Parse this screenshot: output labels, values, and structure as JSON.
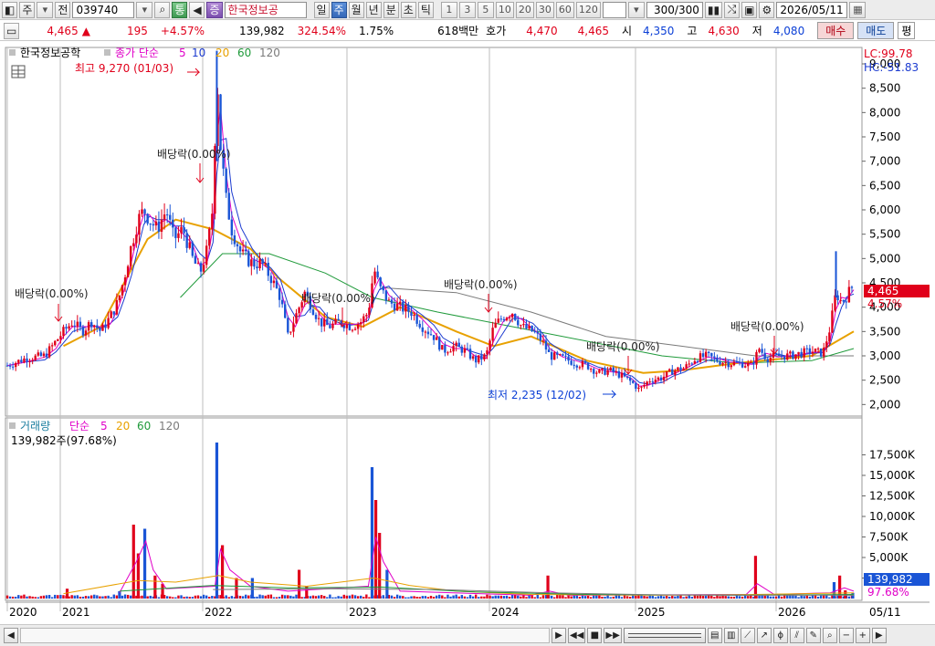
{
  "toolbar": {
    "market": "주",
    "period_mode": "전",
    "stock_code": "039740",
    "btn_tong": "통",
    "btn_jeung": "증",
    "stock_name": "한국정보공",
    "tabs": [
      "일",
      "주",
      "월",
      "년",
      "분",
      "초",
      "틱"
    ],
    "active_tab": "주",
    "intervals": [
      "1",
      "3",
      "5",
      "10",
      "20",
      "30",
      "60",
      "120"
    ],
    "count": "300/300",
    "date": "2026/05/11"
  },
  "quote": {
    "price": "4,465",
    "arrow": "▲",
    "change": "195",
    "change_pct": "+4.57%",
    "volume": "139,982",
    "volume_ratio": "324.54%",
    "turnover": "1.75%",
    "amount": "618백만",
    "hoga_label": "호가",
    "ask": "4,470",
    "bid": "4,465",
    "open_label": "시",
    "open": "4,350",
    "high_label": "고",
    "high": "4,630",
    "low_label": "저",
    "low": "4,080",
    "buy": "매수",
    "sell": "매도",
    "flat": "평"
  },
  "price_panel": {
    "stock_label": "한국정보공학",
    "ma_label": "종가 단순",
    "ma_periods": [
      "5",
      "10",
      "20",
      "60",
      "120"
    ],
    "lc": "LC:99.78",
    "hc": "HC:-51.83",
    "current_price": "4,465",
    "current_pct": "4.57%",
    "high_note": "최고 9,270 (01/03)",
    "low_note": "최저 2,235 (12/02)",
    "dividend_label": "배당락(0.00%)",
    "colors": {
      "ma5": "#e000c8",
      "ma10": "#1c3bd0",
      "ma20": "#e8a100",
      "ma60": "#1f9a3a",
      "ma120": "#7a7a7a",
      "up": "#e0001b",
      "down": "#1a55d6"
    }
  },
  "volume_panel": {
    "label": "거래량",
    "ma_label": "단순",
    "ma_periods": [
      "5",
      "20",
      "60",
      "120"
    ],
    "volume_text": "139,982주(97.68%)",
    "current_volume": "139,982",
    "current_pct": "97.68%"
  },
  "x_axis": {
    "labels": [
      "2020",
      "2021",
      "2022",
      "2023",
      "2024",
      "2025",
      "2026"
    ],
    "end_label": "05/11"
  },
  "chart_data": {
    "type": "candlestick",
    "price_ticks": [
      2000,
      2500,
      3000,
      3500,
      4000,
      4500,
      5000,
      5500,
      6000,
      6500,
      7000,
      7500,
      8000,
      8500,
      9000
    ],
    "price_ylim": [
      1800,
      9300
    ],
    "volume_ticks": [
      "2,500K",
      "5,000K",
      "7,500K",
      "10,000K",
      "12,500K",
      "15,000K",
      "17,500K"
    ],
    "volume_ylim": [
      0,
      20000
    ],
    "volume_unit": "K",
    "years": [
      "2020",
      "2021",
      "2022",
      "2023",
      "2024",
      "2025",
      "2026"
    ],
    "price_path": [
      [
        0,
        2800
      ],
      [
        20,
        2950
      ],
      [
        40,
        3000
      ],
      [
        52,
        3300
      ],
      [
        60,
        3500
      ],
      [
        70,
        3700
      ],
      [
        80,
        3500
      ],
      [
        90,
        3700
      ],
      [
        100,
        3500
      ],
      [
        110,
        3800
      ],
      [
        118,
        4100
      ],
      [
        125,
        4600
      ],
      [
        133,
        5300
      ],
      [
        140,
        5800
      ],
      [
        146,
        6000
      ],
      [
        152,
        5800
      ],
      [
        160,
        5600
      ],
      [
        170,
        6000
      ],
      [
        178,
        5400
      ],
      [
        188,
        5600
      ],
      [
        198,
        5000
      ],
      [
        206,
        4700
      ],
      [
        214,
        5200
      ],
      [
        220,
        6100
      ],
      [
        224,
        8900
      ],
      [
        228,
        7300
      ],
      [
        234,
        6200
      ],
      [
        240,
        5600
      ],
      [
        250,
        5100
      ],
      [
        262,
        4900
      ],
      [
        272,
        4900
      ],
      [
        282,
        4600
      ],
      [
        292,
        4200
      ],
      [
        300,
        3400
      ],
      [
        308,
        3800
      ],
      [
        318,
        4300
      ],
      [
        326,
        4000
      ],
      [
        334,
        3700
      ],
      [
        344,
        3600
      ],
      [
        356,
        3700
      ],
      [
        368,
        3600
      ],
      [
        378,
        3700
      ],
      [
        386,
        3900
      ],
      [
        392,
        4800
      ],
      [
        398,
        4400
      ],
      [
        408,
        4100
      ],
      [
        420,
        4000
      ],
      [
        432,
        3900
      ],
      [
        444,
        3600
      ],
      [
        456,
        3400
      ],
      [
        466,
        3100
      ],
      [
        478,
        3200
      ],
      [
        490,
        3100
      ],
      [
        500,
        2900
      ],
      [
        512,
        3000
      ],
      [
        520,
        3600
      ],
      [
        530,
        3800
      ],
      [
        540,
        3900
      ],
      [
        550,
        3600
      ],
      [
        562,
        3500
      ],
      [
        572,
        3300
      ],
      [
        580,
        3000
      ],
      [
        594,
        2950
      ],
      [
        608,
        2850
      ],
      [
        620,
        2800
      ],
      [
        632,
        2650
      ],
      [
        644,
        2700
      ],
      [
        656,
        2600
      ],
      [
        668,
        2450
      ],
      [
        676,
        2300
      ],
      [
        686,
        2500
      ],
      [
        700,
        2550
      ],
      [
        712,
        2700
      ],
      [
        724,
        2750
      ],
      [
        736,
        2950
      ],
      [
        748,
        3000
      ],
      [
        760,
        2900
      ],
      [
        772,
        2850
      ],
      [
        784,
        2850
      ],
      [
        796,
        2800
      ],
      [
        804,
        3150
      ],
      [
        812,
        2950
      ],
      [
        824,
        3000
      ],
      [
        836,
        3000
      ],
      [
        848,
        3050
      ],
      [
        860,
        3100
      ],
      [
        872,
        3050
      ],
      [
        880,
        3600
      ],
      [
        886,
        4300
      ],
      [
        892,
        4100
      ],
      [
        898,
        4250
      ],
      [
        905,
        4465
      ]
    ],
    "ma20": [
      [
        60,
        3200
      ],
      [
        100,
        3600
      ],
      [
        150,
        5400
      ],
      [
        180,
        5800
      ],
      [
        220,
        5600
      ],
      [
        260,
        5200
      ],
      [
        290,
        4600
      ],
      [
        340,
        3800
      ],
      [
        380,
        3600
      ],
      [
        420,
        4000
      ],
      [
        480,
        3500
      ],
      [
        520,
        3200
      ],
      [
        560,
        3400
      ],
      [
        620,
        2900
      ],
      [
        680,
        2650
      ],
      [
        720,
        2700
      ],
      [
        780,
        2850
      ],
      [
        860,
        3000
      ],
      [
        905,
        3500
      ]
    ],
    "ma60": [
      [
        185,
        4200
      ],
      [
        230,
        5100
      ],
      [
        280,
        5100
      ],
      [
        340,
        4700
      ],
      [
        390,
        4200
      ],
      [
        460,
        3900
      ],
      [
        540,
        3600
      ],
      [
        620,
        3300
      ],
      [
        700,
        3000
      ],
      [
        780,
        2850
      ],
      [
        860,
        2900
      ],
      [
        905,
        3150
      ]
    ],
    "ma120": [
      [
        400,
        4400
      ],
      [
        480,
        4300
      ],
      [
        560,
        3900
      ],
      [
        640,
        3400
      ],
      [
        720,
        3200
      ],
      [
        800,
        3000
      ],
      [
        905,
        3000
      ]
    ],
    "volume_bars": [
      [
        64,
        1200
      ],
      [
        120,
        900
      ],
      [
        135,
        9000
      ],
      [
        140,
        5500
      ],
      [
        147,
        8500
      ],
      [
        158,
        2800
      ],
      [
        166,
        1800
      ],
      [
        224,
        19000
      ],
      [
        230,
        6500
      ],
      [
        245,
        2500
      ],
      [
        262,
        2500
      ],
      [
        312,
        3500
      ],
      [
        320,
        1500
      ],
      [
        390,
        16000
      ],
      [
        394,
        12000
      ],
      [
        398,
        8000
      ],
      [
        406,
        3500
      ],
      [
        578,
        2800
      ],
      [
        800,
        5200
      ],
      [
        884,
        2000
      ],
      [
        890,
        2800
      ],
      [
        896,
        1000
      ],
      [
        904,
        700
      ]
    ]
  }
}
